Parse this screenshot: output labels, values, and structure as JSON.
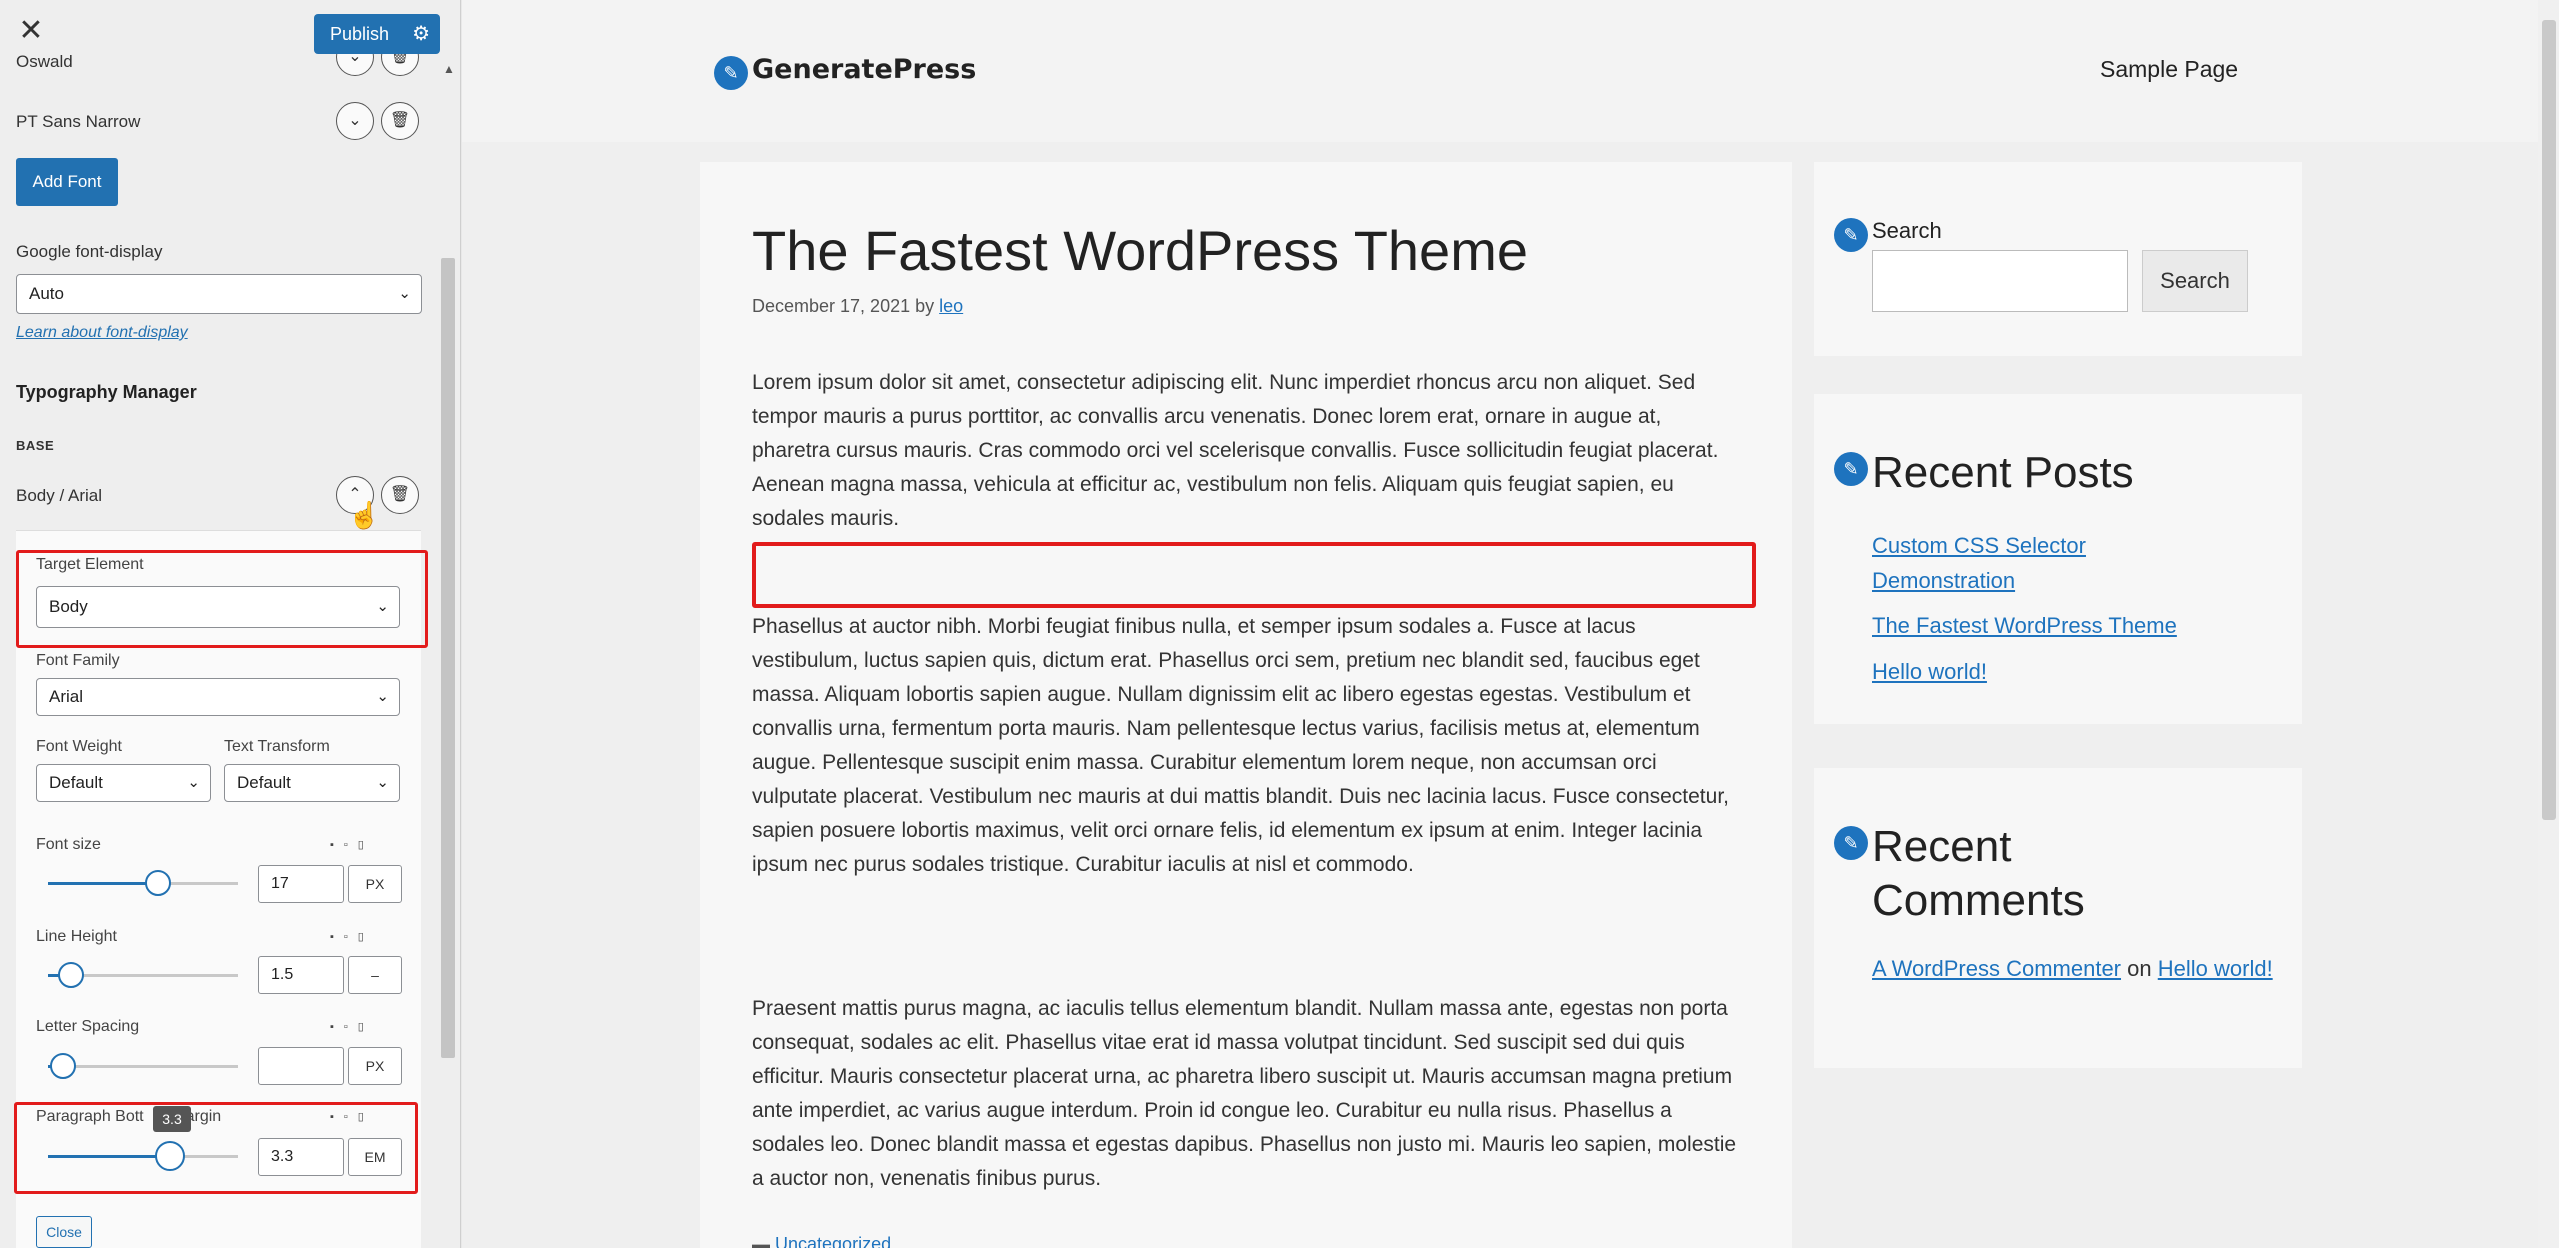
{
  "customizer": {
    "close_label": "✕",
    "publish_label": "Publish",
    "fonts": [
      {
        "name": "Oswald"
      },
      {
        "name": "PT Sans Narrow"
      }
    ],
    "add_font_label": "Add Font",
    "font_display": {
      "label": "Google font-display",
      "value": "Auto",
      "help_link": "Learn about font-display"
    },
    "typography_manager": {
      "heading": "Typography Manager",
      "section": "BASE",
      "item": "Body / Arial"
    },
    "panel": {
      "target_element": {
        "label": "Target Element",
        "value": "Body"
      },
      "font_family": {
        "label": "Font Family",
        "value": "Arial"
      },
      "font_weight": {
        "label": "Font Weight",
        "value": "Default"
      },
      "text_transform": {
        "label": "Text Transform",
        "value": "Default"
      },
      "font_size": {
        "label": "Font size",
        "value": "17",
        "unit": "PX",
        "fraction": 0.58
      },
      "line_height": {
        "label": "Line Height",
        "value": "1.5",
        "unit": "–",
        "fraction": 0.12
      },
      "letter_spacing": {
        "label": "Letter Spacing",
        "value": "",
        "unit": "PX",
        "fraction": 0.08
      },
      "paragraph_margin": {
        "label": "Paragraph Bott",
        "label_tail": "argin",
        "value": "3.3",
        "unit": "EM",
        "tooltip": "3.3",
        "fraction": 0.64
      },
      "close_label": "Close"
    }
  },
  "site": {
    "title": "GeneratePress",
    "nav": [
      "Sample Page"
    ],
    "post": {
      "title": "The Fastest WordPress Theme",
      "date": "December 17, 2021",
      "by": "by",
      "author": "leo",
      "paragraphs": [
        "Lorem ipsum dolor sit amet, consectetur adipiscing elit. Nunc imperdiet rhoncus arcu non aliquet. Sed tempor mauris a purus porttitor, ac convallis arcu venenatis. Donec lorem erat, ornare in augue at, pharetra cursus mauris. Cras commodo orci vel scelerisque convallis. Fusce sollicitudin feugiat placerat. Aenean magna massa, vehicula at efficitur ac, vestibulum non felis. Aliquam quis feugiat sapien, eu sodales mauris.",
        "Phasellus at auctor nibh. Morbi feugiat finibus nulla, et semper ipsum sodales a. Fusce at lacus vestibulum, luctus sapien quis, dictum erat. Phasellus orci sem, pretium nec blandit sed, faucibus eget massa. Aliquam lobortis sapien augue. Nullam dignissim elit ac libero egestas egestas. Vestibulum et convallis urna, fermentum porta mauris. Nam pellentesque lectus varius, facilisis metus at, elementum augue. Pellentesque suscipit enim massa. Curabitur elementum lorem neque, non accumsan orci vulputate placerat. Vestibulum nec mauris at dui mattis blandit. Duis nec lacinia lacus. Fusce consectetur, sapien posuere lobortis maximus, velit orci ornare felis, id elementum ex ipsum at enim. Integer lacinia ipsum nec purus sodales tristique. Curabitur iaculis at nisl et commodo.",
        "Praesent mattis purus magna, ac iaculis tellus elementum blandit. Nullam massa ante, egestas non porta consequat, sodales ac elit. Phasellus vitae erat id massa volutpat tincidunt. Sed suscipit sed dui quis efficitur. Mauris consectetur placerat urna, ac pharetra libero suscipit ut. Mauris accumsan magna pretium ante imperdiet, ac varius augue interdum. Proin id congue leo. Curabitur eu nulla risus. Phasellus a sodales leo. Donec blandit massa et egestas dapibus. Phasellus non justo mi. Mauris leo sapien, molestie a auctor non, venenatis finibus purus."
      ],
      "category": "Uncategorized"
    },
    "sidebar": {
      "search_label": "Search",
      "search_button": "Search",
      "recent_posts_title": "Recent Posts",
      "recent_posts": [
        "Custom CSS Selector Demonstration",
        "The Fastest WordPress Theme",
        "Hello world!"
      ],
      "recent_comments_title": "Recent Comments",
      "comment_author": "A WordPress Commenter",
      "comment_on": "on",
      "comment_post": "Hello world!"
    }
  },
  "colors": {
    "accent": "#2271b1",
    "link": "#1e73be",
    "highlight": "#e21b1b"
  }
}
